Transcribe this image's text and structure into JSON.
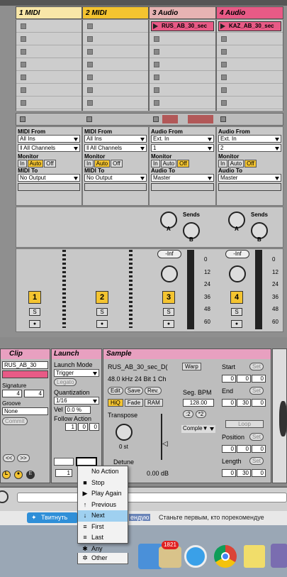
{
  "tracks": [
    {
      "name": "1 MIDI",
      "color": "#f8e6a8"
    },
    {
      "name": "2 MIDI",
      "color": "#f4c430"
    },
    {
      "name": "3 Audio",
      "color": "#e6b3b3"
    },
    {
      "name": "4 Audio",
      "color": "#e85a86"
    }
  ],
  "clips": {
    "track3": "RUS_AB_30_sec",
    "track4": "KAZ_AB_30_sec"
  },
  "io": [
    {
      "from_label": "MIDI From",
      "from": "All Ins",
      "ch": "‖ All Channels",
      "mon_label": "Monitor",
      "to_label": "MIDI To",
      "to": "No Output"
    },
    {
      "from_label": "MIDI From",
      "from": "All Ins",
      "ch": "‖ All Channels",
      "mon_label": "Monitor",
      "to_label": "MIDI To",
      "to": "No Output"
    },
    {
      "from_label": "Audio From",
      "from": "Ext. In",
      "ch": "1",
      "mon_label": "Monitor",
      "to_label": "Audio To",
      "to": "Master"
    },
    {
      "from_label": "Audio From",
      "from": "Ext. In",
      "ch": "2",
      "mon_label": "Monitor",
      "to_label": "Audio To",
      "to": "Master"
    }
  ],
  "monitor": [
    "In",
    "Auto",
    "Off"
  ],
  "sends": {
    "label": "Sends",
    "a": "A",
    "b": "B"
  },
  "mixer": {
    "inf": "-Inf",
    "scale": [
      "0",
      "12",
      "24",
      "36",
      "48",
      "60"
    ],
    "numbers": [
      "1",
      "2",
      "3",
      "4"
    ],
    "solo": "S"
  },
  "clip_panel": {
    "title": "Clip",
    "name": "RUS_AB_30",
    "signature_label": "Signature",
    "sig_num": "4",
    "sig_den": "4",
    "groove_label": "Groove",
    "groove": "None",
    "commit": "Commit"
  },
  "launch_panel": {
    "title": "Launch",
    "mode_label": "Launch Mode",
    "mode": "Trigger",
    "legato": "Legato",
    "quant_label": "Quantization",
    "quant": "1/16",
    "vel_label": "Vel",
    "vel": "0.0 %",
    "follow_label": "Follow Action",
    "fa_a": "1",
    "fa_b": "0",
    "fa_c": "0",
    "bottom": "1"
  },
  "sample_panel": {
    "title": "Sample",
    "file": "RUS_AB_30_sec_D(",
    "info": "48.0 kHz 24 Bit 1 Ch",
    "warp": "Warp",
    "edit": "Edit",
    "save": "Save",
    "rev": "Rev.",
    "hiq": "HiQ",
    "fade": "Fade",
    "ram": "RAM",
    "seg_bpm_label": "Seg. BPM",
    "seg_bpm": "128.00",
    "half": ":2",
    "dbl": "*2",
    "transpose_label": "Transpose",
    "transpose": "0 st",
    "detune_label": "Detune",
    "gain": "0.00 dB",
    "mode": "Comple▼",
    "start_label": "Start",
    "end_label": "End",
    "set": "Set",
    "start": [
      "0",
      "0",
      "0"
    ],
    "end": [
      "0",
      "30",
      "0"
    ],
    "loop": "Loop",
    "position_label": "Position",
    "position": [
      "0",
      "0",
      "0"
    ],
    "length_label": "Length",
    "length": [
      "0",
      "30",
      "0"
    ]
  },
  "menu": {
    "items": [
      {
        "label": "No Action",
        "icon": ""
      },
      {
        "label": "Stop",
        "icon": "■"
      },
      {
        "label": "Play Again",
        "icon": "▶"
      },
      {
        "label": "Previous",
        "icon": "↑"
      },
      {
        "label": "Next",
        "icon": "↓"
      },
      {
        "label": "First",
        "icon": "≡"
      },
      {
        "label": "Last",
        "icon": "≡"
      },
      {
        "label": "Any",
        "icon": "✱"
      },
      {
        "label": "Other",
        "icon": "✲"
      }
    ],
    "selected_index": 4
  },
  "browser_bar": {
    "twitter": "Твитнуть",
    "text_a": "ендую",
    "text_b": "Станьте первым, кто порекомендуе"
  },
  "dock": {
    "badge": "1821"
  }
}
